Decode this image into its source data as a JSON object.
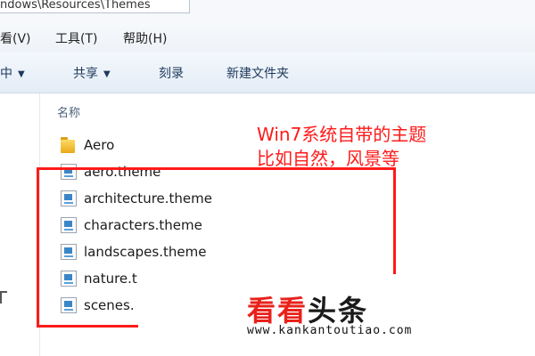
{
  "address_bar": {
    "path": "ndows\\Resources\\Themes"
  },
  "menu": [
    "看(V)",
    "工具(T)",
    "帮助(H)"
  ],
  "toolbar": {
    "include_label": "中",
    "share_label": "共享",
    "burn_label": "刻录",
    "new_folder_label": "新建文件夹"
  },
  "column_header": "名称",
  "files": [
    {
      "name": "Aero",
      "icon": "folder-icon"
    },
    {
      "name": "aero.theme",
      "icon": "theme-file-icon"
    },
    {
      "name": "architecture.theme",
      "icon": "theme-file-icon"
    },
    {
      "name": "characters.theme",
      "icon": "theme-file-icon"
    },
    {
      "name": "landscapes.theme",
      "icon": "theme-file-icon"
    },
    {
      "name": "nature.t",
      "icon": "theme-file-icon"
    },
    {
      "name": "scenes.",
      "icon": "theme-file-icon"
    }
  ],
  "annotation": {
    "line1": "Win7系统自带的主题",
    "line2": "比如自然，风景等",
    "color": "#ff1a1a"
  },
  "watermark": {
    "title_red": "看看",
    "title_black": "头条",
    "url": "www.kankantoutiao.com"
  }
}
